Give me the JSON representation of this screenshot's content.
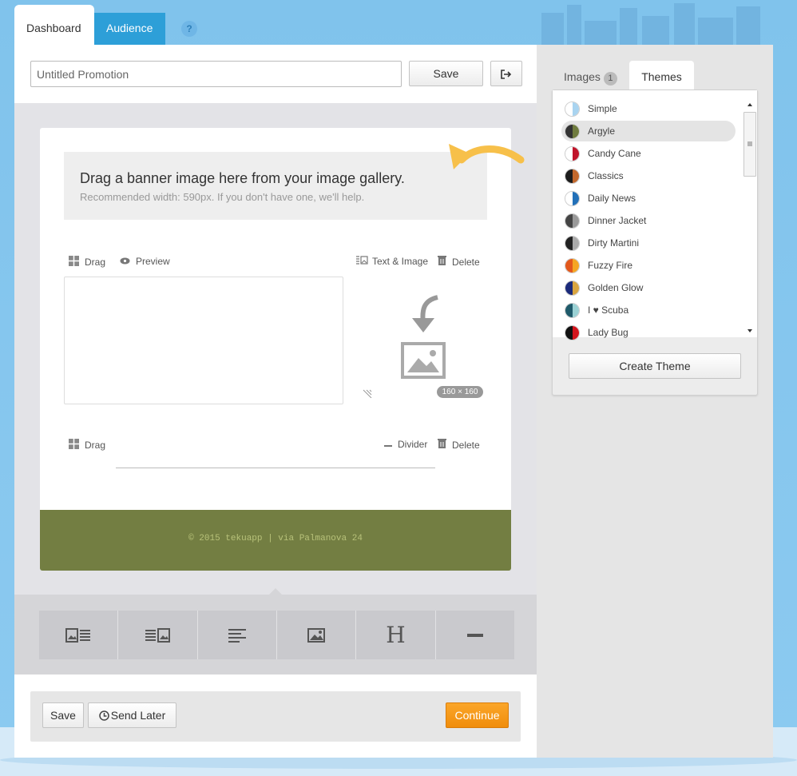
{
  "nav": {
    "tabs": [
      {
        "label": "Dashboard",
        "active": true
      },
      {
        "label": "Audience",
        "active": false
      }
    ],
    "help_label": "?"
  },
  "topbar": {
    "title_value": "Untitled Promotion",
    "save_label": "Save",
    "exit_icon": "sign-out-icon"
  },
  "banner": {
    "title": "Drag a banner image here from your image gallery.",
    "subtitle": "Recommended width: 590px. If you don't have one, we'll help."
  },
  "block1": {
    "drag_label": "Drag",
    "preview_label": "Preview",
    "type_label": "Text & Image",
    "delete_label": "Delete",
    "image_size": "160 × 160"
  },
  "block2": {
    "drag_label": "Drag",
    "type_label": "Divider",
    "delete_label": "Delete"
  },
  "footer": {
    "text": "© 2015 tekuapp | via Palmanova 24"
  },
  "block_types": [
    {
      "name": "image-left-text",
      "icon": "image-text-icon"
    },
    {
      "name": "text-image-right",
      "icon": "text-image-icon"
    },
    {
      "name": "text",
      "icon": "text-align-icon"
    },
    {
      "name": "image",
      "icon": "image-icon"
    },
    {
      "name": "heading",
      "icon": "heading-icon",
      "glyph": "H"
    },
    {
      "name": "divider",
      "icon": "divider-icon"
    }
  ],
  "actions": {
    "save_label": "Save",
    "send_later_label": "Send Later",
    "continue_label": "Continue"
  },
  "sidebar": {
    "images_tab": "Images",
    "images_count": "1",
    "themes_tab": "Themes",
    "create_theme_label": "Create Theme",
    "themes": [
      {
        "name": "Simple",
        "colors": [
          "#ffffff",
          "#a9d4f0"
        ]
      },
      {
        "name": "Argyle",
        "colors": [
          "#333333",
          "#6f7b3e"
        ],
        "selected": true
      },
      {
        "name": "Candy Cane",
        "colors": [
          "#ffffff",
          "#c0142a"
        ]
      },
      {
        "name": "Classics",
        "colors": [
          "#1c1c1c",
          "#c2682c"
        ]
      },
      {
        "name": "Daily News",
        "colors": [
          "#ffffff",
          "#2270b8"
        ]
      },
      {
        "name": "Dinner Jacket",
        "colors": [
          "#444444",
          "#999999"
        ]
      },
      {
        "name": "Dirty Martini",
        "colors": [
          "#222222",
          "#aaaaaa"
        ]
      },
      {
        "name": "Fuzzy Fire",
        "colors": [
          "#e2581c",
          "#f5a623"
        ]
      },
      {
        "name": "Golden Glow",
        "colors": [
          "#1b2a7a",
          "#d9a540"
        ]
      },
      {
        "name": "I ♥ Scuba",
        "colors": [
          "#1f5a6a",
          "#9ad1d4"
        ]
      },
      {
        "name": "Lady Bug",
        "colors": [
          "#111111",
          "#d3141c"
        ]
      }
    ]
  },
  "colors": {
    "accent_blue": "#2d9fd8",
    "footer_olive": "#737e42",
    "continue_orange": "#f49b1c"
  }
}
